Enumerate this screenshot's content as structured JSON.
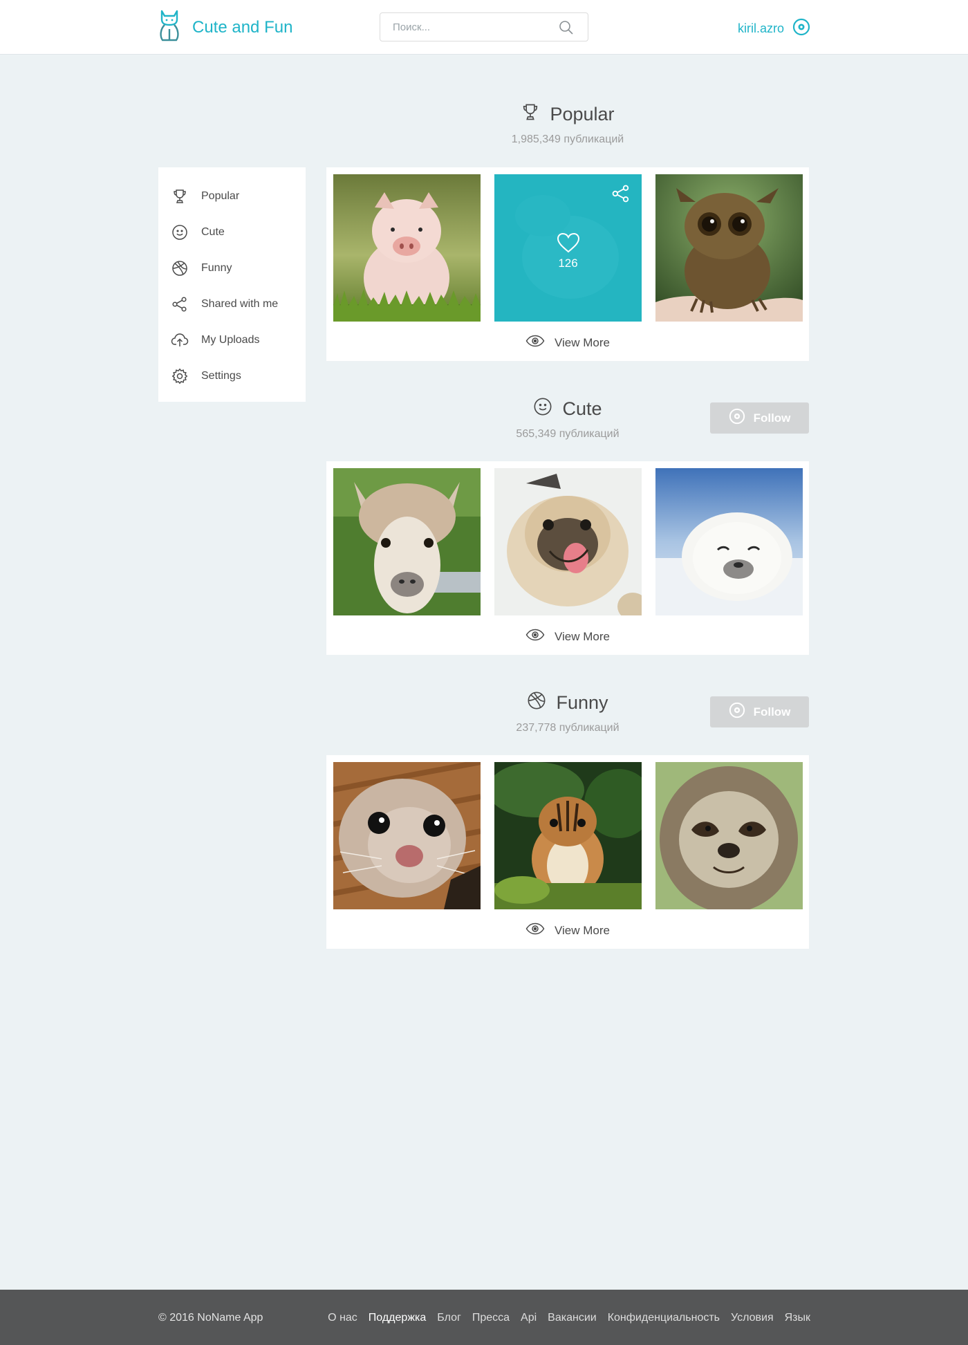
{
  "app": {
    "title": "Cute and Fun"
  },
  "search": {
    "placeholder": "Поиск..."
  },
  "user": {
    "name": "kiril.azro"
  },
  "sidebar": {
    "items": [
      {
        "label": "Popular",
        "icon": "trophy-icon"
      },
      {
        "label": "Cute",
        "icon": "smiley-icon"
      },
      {
        "label": "Funny",
        "icon": "dribbble-ball-icon"
      },
      {
        "label": "Shared with me",
        "icon": "share-icon"
      },
      {
        "label": "My Uploads",
        "icon": "cloud-upload-icon"
      },
      {
        "label": "Settings",
        "icon": "gear-icon"
      }
    ]
  },
  "sections": [
    {
      "title": "Popular",
      "icon": "trophy-icon",
      "count": "1,985,349 публикаций",
      "view_more": "View More",
      "images": [
        "piglet-photo",
        "kitten-photo",
        "tarsier-photo"
      ],
      "hovered": {
        "likes": "126"
      }
    },
    {
      "title": "Cute",
      "icon": "smiley-icon",
      "count": "565,349 публикаций",
      "follow": "Follow",
      "view_more": "View More",
      "images": [
        "alpaca-photo",
        "pug-photo",
        "seal-pup-photo"
      ]
    },
    {
      "title": "Funny",
      "icon": "dribbble-ball-icon",
      "count": "237,778 публикаций",
      "follow": "Follow",
      "view_more": "View More",
      "images": [
        "squirrel-photo",
        "chipmunk-photo",
        "sloth-photo"
      ]
    }
  ],
  "footer": {
    "copyright": "© 2016 NoName App",
    "links": [
      "О нас",
      "Поддержка",
      "Блог",
      "Пресса",
      "Api",
      "Вакансии",
      "Конфиденциальность",
      "Условия",
      "Язык"
    ]
  },
  "colors": {
    "accent": "#1fb4c8",
    "background": "#ecf2f4",
    "footer": "#555657",
    "follow_button": "#d3d5d6"
  }
}
